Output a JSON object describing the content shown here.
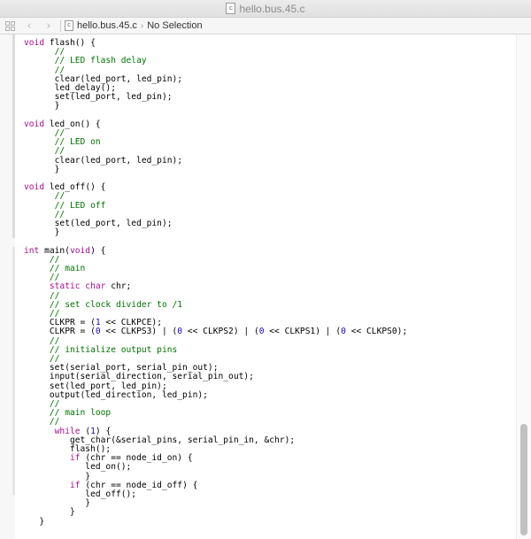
{
  "window": {
    "title": "hello.bus.45.c",
    "file_icon_glyph": "c"
  },
  "navbar": {
    "back_icon": "‹",
    "forward_icon": "›",
    "file_name": "hello.bus.45.c",
    "crumb_separator": "›",
    "selection_label": "No Selection"
  },
  "colors": {
    "keyword": "#aa0d91",
    "comment": "#007400",
    "number": "#1c00cf"
  },
  "code": {
    "lines": [
      [
        [
          "kw",
          "void"
        ],
        [
          "t",
          " flash() {"
        ]
      ],
      [
        [
          "cm",
          "      //"
        ]
      ],
      [
        [
          "cm",
          "      // LED flash delay"
        ]
      ],
      [
        [
          "cm",
          "      //"
        ]
      ],
      [
        [
          "t",
          "      clear(led_port, led_pin);"
        ]
      ],
      [
        [
          "t",
          "      led_delay();"
        ]
      ],
      [
        [
          "t",
          "      set(led_port, led_pin);"
        ]
      ],
      [
        [
          "t",
          "      }"
        ]
      ],
      [],
      [
        [
          "kw",
          "void"
        ],
        [
          "t",
          " led_on() {"
        ]
      ],
      [
        [
          "cm",
          "      //"
        ]
      ],
      [
        [
          "cm",
          "      // LED on"
        ]
      ],
      [
        [
          "cm",
          "      //"
        ]
      ],
      [
        [
          "t",
          "      clear(led_port, led_pin);"
        ]
      ],
      [
        [
          "t",
          "      }"
        ]
      ],
      [],
      [
        [
          "kw",
          "void"
        ],
        [
          "t",
          " led_off() {"
        ]
      ],
      [
        [
          "cm",
          "      //"
        ]
      ],
      [
        [
          "cm",
          "      // LED off"
        ]
      ],
      [
        [
          "cm",
          "      //"
        ]
      ],
      [
        [
          "t",
          "      set(led_port, led_pin);"
        ]
      ],
      [
        [
          "t",
          "      }"
        ]
      ],
      [],
      [
        [
          "kw",
          "int"
        ],
        [
          "t",
          " main("
        ],
        [
          "kw",
          "void"
        ],
        [
          "t",
          ") {"
        ]
      ],
      [
        [
          "cm",
          "     //"
        ]
      ],
      [
        [
          "cm",
          "     // main"
        ]
      ],
      [
        [
          "cm",
          "     //"
        ]
      ],
      [
        [
          "kw",
          "     static char"
        ],
        [
          "t",
          " chr;"
        ]
      ],
      [
        [
          "cm",
          "     //"
        ]
      ],
      [
        [
          "cm",
          "     // set clock divider to /1"
        ]
      ],
      [
        [
          "cm",
          "     //"
        ]
      ],
      [
        [
          "t",
          "     CLKPR = ("
        ],
        [
          "num",
          "1"
        ],
        [
          "t",
          " << CLKPCE);"
        ]
      ],
      [
        [
          "t",
          "     CLKPR = ("
        ],
        [
          "num",
          "0"
        ],
        [
          "t",
          " << CLKPS3) | ("
        ],
        [
          "num",
          "0"
        ],
        [
          "t",
          " << CLKPS2) | ("
        ],
        [
          "num",
          "0"
        ],
        [
          "t",
          " << CLKPS1) | ("
        ],
        [
          "num",
          "0"
        ],
        [
          "t",
          " << CLKPS0);"
        ]
      ],
      [
        [
          "cm",
          "     //"
        ]
      ],
      [
        [
          "cm",
          "     // initialize output pins"
        ]
      ],
      [
        [
          "cm",
          "     //"
        ]
      ],
      [
        [
          "t",
          "     set(serial_port, serial_pin_out);"
        ]
      ],
      [
        [
          "t",
          "     input(serial_direction, serial_pin_out);"
        ]
      ],
      [
        [
          "t",
          "     set(led_port, led_pin);"
        ]
      ],
      [
        [
          "t",
          "     output(led_direction, led_pin);"
        ]
      ],
      [
        [
          "cm",
          "     //"
        ]
      ],
      [
        [
          "cm",
          "     // main loop"
        ]
      ],
      [
        [
          "cm",
          "     //"
        ]
      ],
      [
        [
          "kw",
          "      while"
        ],
        [
          "t",
          " ("
        ],
        [
          "num",
          "1"
        ],
        [
          "t",
          ") {"
        ]
      ],
      [
        [
          "t",
          "         get_char(&serial_pins, serial_pin_in, &chr);"
        ]
      ],
      [
        [
          "t",
          "         flash();"
        ]
      ],
      [
        [
          "kw",
          "         if"
        ],
        [
          "t",
          " (chr == node_id_on) {"
        ]
      ],
      [
        [
          "t",
          "            led_on();"
        ]
      ],
      [
        [
          "t",
          "            }"
        ]
      ],
      [
        [
          "kw",
          "         if"
        ],
        [
          "t",
          " (chr == node_id_off) {"
        ]
      ],
      [
        [
          "t",
          "            led_off();"
        ]
      ],
      [
        [
          "t",
          "            }"
        ]
      ],
      [
        [
          "t",
          "         }"
        ]
      ],
      [
        [
          "t",
          "   }"
        ]
      ]
    ]
  }
}
